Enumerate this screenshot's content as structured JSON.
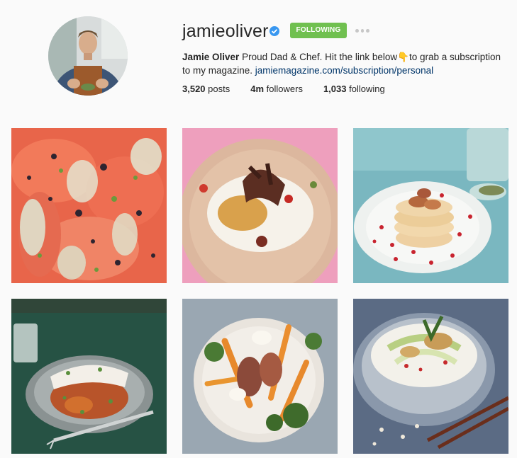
{
  "profile": {
    "username": "jamieoliver",
    "follow_label": "FOLLOWING",
    "full_name": "Jamie Oliver",
    "bio_text": " Proud Dad & Chef. Hit the link below👇to grab a subscription to my magazine. ",
    "link": "jamiemagazine.com/subscription/personal"
  },
  "stats": {
    "posts_count": "3,520",
    "posts_label": " posts",
    "followers_count": "4m",
    "followers_label": " followers",
    "following_count": "1,033",
    "following_label": " following"
  },
  "colors": {
    "follow_button": "#70c050",
    "verified_badge": "#3897f0",
    "link": "#003569"
  },
  "posts": [
    {
      "name": "salmon-carpaccio-photo"
    },
    {
      "name": "flatbread-rice-photo"
    },
    {
      "name": "fig-pancakes-photo"
    },
    {
      "name": "fish-lentils-photo"
    },
    {
      "name": "roast-vegetables-photo"
    },
    {
      "name": "noodle-salad-photo"
    }
  ]
}
